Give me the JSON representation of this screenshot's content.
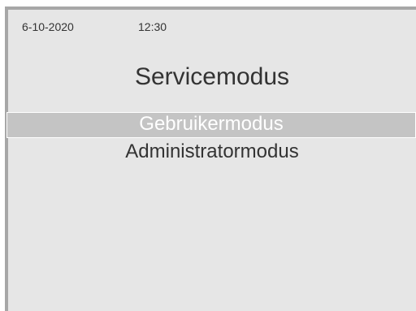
{
  "status": {
    "date": "6-10-2020",
    "time": "12:30"
  },
  "screen": {
    "title": "Servicemodus"
  },
  "menu": {
    "items": [
      {
        "label": "Gebruikermodus",
        "selected": true
      },
      {
        "label": "Administratormodus",
        "selected": false
      }
    ]
  },
  "colors": {
    "background": "#e6e6e6",
    "highlight": "#c4c4c4",
    "text": "#333333",
    "border": "#a7a7a7"
  }
}
